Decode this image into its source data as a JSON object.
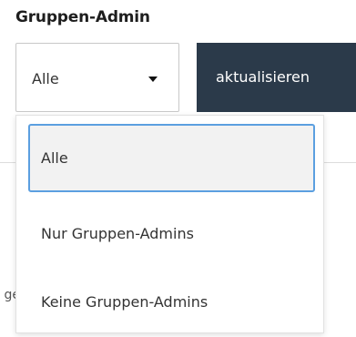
{
  "filter": {
    "label": "Gruppen-Admin",
    "selected_value": "Alle",
    "caret_icon": "caret-down-icon"
  },
  "refresh_button": {
    "label": "aktualisieren"
  },
  "background_text": "ge",
  "dropdown": {
    "options": [
      {
        "label": "Alle",
        "selected": true
      },
      {
        "label": "Nur Gruppen-Admins",
        "selected": false
      },
      {
        "label": "Keine Gruppen-Admins",
        "selected": false
      }
    ]
  },
  "colors": {
    "button_bg": "#2b3a4a",
    "focus_border": "#5b9fe0",
    "selected_bg": "#f2f2f2"
  }
}
